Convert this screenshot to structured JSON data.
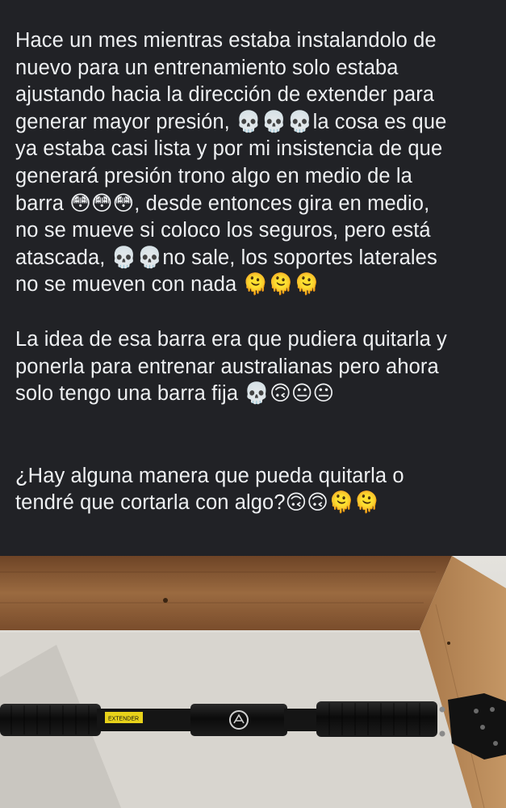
{
  "post": {
    "paragraphs": [
      {
        "lines": [
          "Hace un mes mientras estaba instalandolo de",
          "nuevo para un entrenamiento solo estaba",
          "ajustando hacia la dirección de extender para",
          "generar mayor presión, 💀💀💀la cosa es que",
          "ya estaba casi lista y por mi insistencia de que",
          "generará presión trono algo en medio de la",
          "barra 😳😳😳, desde entonces gira en medio,",
          "no se mueve si coloco los seguros, pero está",
          "atascada, 💀💀no sale, los soportes laterales",
          "no se mueven con nada 🫠🫠🫠"
        ]
      },
      {
        "lines": [
          "La idea de esa barra era que pudiera quitarla y",
          "ponerla para entrenar australianas pero ahora",
          "solo tengo una barra fija 💀🙃😐😐"
        ]
      },
      {
        "lines": [
          "¿Hay alguna manera que pueda quitarla o",
          "tendré que cortarla con algo?🙃🙃🫠🫠"
        ]
      }
    ]
  },
  "photo": {
    "bar_label": "EXTENDER",
    "colors": {
      "wall": "#d9d6d0",
      "wood": "#8a5a36",
      "bar": "#141414",
      "label": "#e8d21a"
    }
  }
}
